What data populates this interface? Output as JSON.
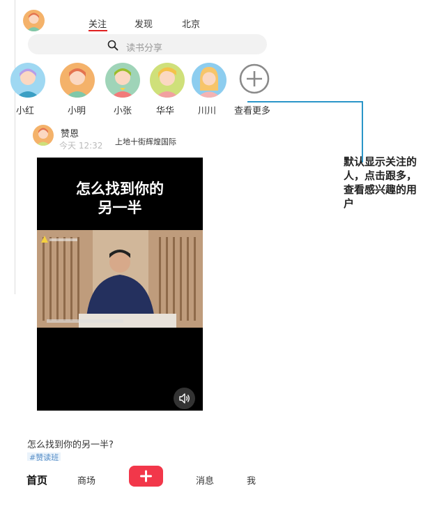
{
  "header": {
    "tabs": [
      {
        "label": "关注",
        "active": true
      },
      {
        "label": "发现",
        "active": false
      },
      {
        "label": "北京",
        "active": false
      }
    ],
    "accent_color": "#e02020"
  },
  "search": {
    "placeholder": "读书分享"
  },
  "stories": {
    "users": [
      {
        "name": "小红"
      },
      {
        "name": "小明"
      },
      {
        "name": "小张"
      },
      {
        "name": "华华"
      },
      {
        "name": "川川"
      }
    ],
    "more_label": "查看更多"
  },
  "annotation": {
    "text": "默认显示关注的人，点击跟多，查看感兴趣的用户",
    "line_color": "#2a95c8"
  },
  "post": {
    "username": "赞恩",
    "time": "今天 12:32",
    "location": "上地十街辉煌国际",
    "video": {
      "title_line1": "怎么找到你的",
      "title_line2": "另一半",
      "sound_icon": "speaker-icon"
    },
    "caption": "怎么找到你的另一半?",
    "tag": "#赞读班"
  },
  "bottom_nav": {
    "home": "首页",
    "mall": "商场",
    "add_icon": "plus-icon",
    "add_color": "#f2374a",
    "messages": "消息",
    "me": "我"
  }
}
